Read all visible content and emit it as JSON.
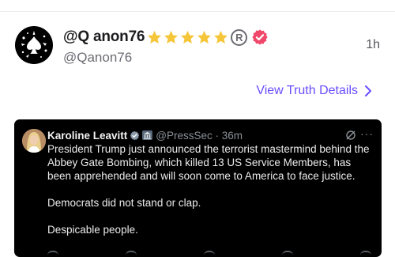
{
  "post": {
    "display_name": "@Q anon76",
    "handle": "@Qanon76",
    "time_ago": "1h",
    "reg_symbol": "R",
    "star_count": 5,
    "star_color": "#f5c63a",
    "verified_color": "#f0486b"
  },
  "details_link": {
    "label": "View Truth Details"
  },
  "embed": {
    "author_name": "Karoline Leavitt",
    "author_meta": "@PressSec · 36m",
    "paragraphs": [
      "President Trump just announced the terrorist mastermind behind the Abbey Gate Bombing, which killed 13 US Service Members, has been apprehended and will soon come to America to face justice.",
      "Democrats did not stand or clap.",
      "Despicable people."
    ],
    "verified_color": "#8a98a8",
    "more_glyph": "···"
  },
  "icons": {
    "avatar": "spade-splatter-icon",
    "star": "star-icon",
    "verified": "verified-badge-icon",
    "chevron": "chevron-right-icon"
  }
}
